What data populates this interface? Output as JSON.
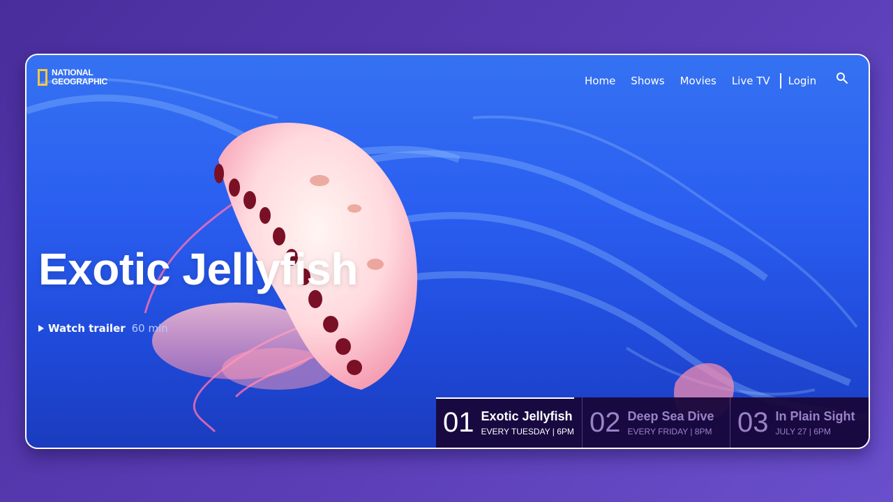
{
  "brand": {
    "line1": "NATIONAL",
    "line2": "GEOGRAPHIC",
    "frame_color": "#f6c744"
  },
  "nav": {
    "items": [
      "Home",
      "Shows",
      "Movies",
      "Live TV"
    ],
    "login": "Login",
    "search_icon": "search-icon"
  },
  "hero": {
    "title": "Exotic Jellyfish",
    "trailer_label": "Watch trailer",
    "duration": "60 min"
  },
  "episodes": [
    {
      "number": "01",
      "title": "Exotic Jellyfish",
      "schedule": "EVERY TUESDAY | 6PM",
      "active": true
    },
    {
      "number": "02",
      "title": "Deep Sea Dive",
      "schedule": "EVERY FRIDAY | 8PM",
      "active": false
    },
    {
      "number": "03",
      "title": "In Plain Sight",
      "schedule": "JULY 27 | 6PM",
      "active": false
    }
  ],
  "colors": {
    "accent": "#f6c744",
    "page_background": "#5a3db5",
    "ocean": "#2a5ef0",
    "episode_panel": "#180638",
    "dim_text": "#9b82c7"
  }
}
